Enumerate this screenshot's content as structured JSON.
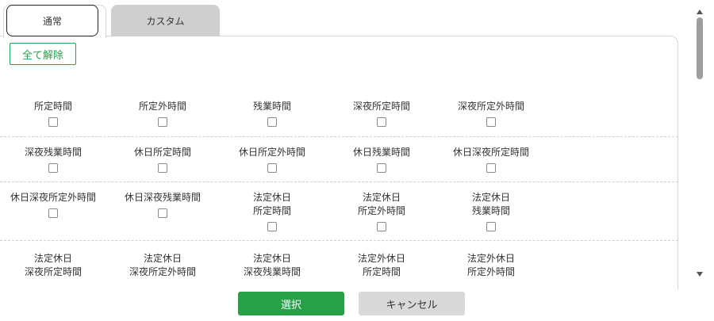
{
  "tabs": [
    {
      "label": "通常",
      "active": true
    },
    {
      "label": "カスタム",
      "active": false
    }
  ],
  "clear_all_label": "全て解除",
  "rows": [
    {
      "items": [
        {
          "lines": [
            "所定時間"
          ],
          "checked": false
        },
        {
          "lines": [
            "所定外時間"
          ],
          "checked": false
        },
        {
          "lines": [
            "残業時間"
          ],
          "checked": false
        },
        {
          "lines": [
            "深夜所定時間"
          ],
          "checked": false
        },
        {
          "lines": [
            "深夜所定外時間"
          ],
          "checked": false
        }
      ]
    },
    {
      "items": [
        {
          "lines": [
            "深夜残業時間"
          ],
          "checked": false
        },
        {
          "lines": [
            "休日所定時間"
          ],
          "checked": false
        },
        {
          "lines": [
            "休日所定外時間"
          ],
          "checked": false
        },
        {
          "lines": [
            "休日残業時間"
          ],
          "checked": false
        },
        {
          "lines": [
            "休日深夜所定時間"
          ],
          "checked": false
        }
      ]
    },
    {
      "items": [
        {
          "lines": [
            "休日深夜所定外時間"
          ],
          "checked": false
        },
        {
          "lines": [
            "休日深夜残業時間"
          ],
          "checked": false
        },
        {
          "lines": [
            "法定休日",
            "所定時間"
          ],
          "checked": false
        },
        {
          "lines": [
            "法定休日",
            "所定外時間"
          ],
          "checked": false
        },
        {
          "lines": [
            "法定休日",
            "残業時間"
          ],
          "checked": false
        }
      ]
    },
    {
      "items": [
        {
          "lines": [
            "法定休日",
            "深夜所定時間"
          ],
          "checked": false
        },
        {
          "lines": [
            "法定休日",
            "深夜所定外時間"
          ],
          "checked": false
        },
        {
          "lines": [
            "法定休日",
            "深夜残業時間"
          ],
          "checked": false
        },
        {
          "lines": [
            "法定外休日",
            "所定時間"
          ],
          "checked": false
        },
        {
          "lines": [
            "法定外休日",
            "所定外時間"
          ],
          "checked": false
        }
      ]
    }
  ],
  "buttons": {
    "select": "選択",
    "cancel": "キャンセル"
  },
  "colors": {
    "accent": "#27a047",
    "cancel_bg": "#d9d9d9",
    "tab_inactive": "#cfcfcf"
  }
}
